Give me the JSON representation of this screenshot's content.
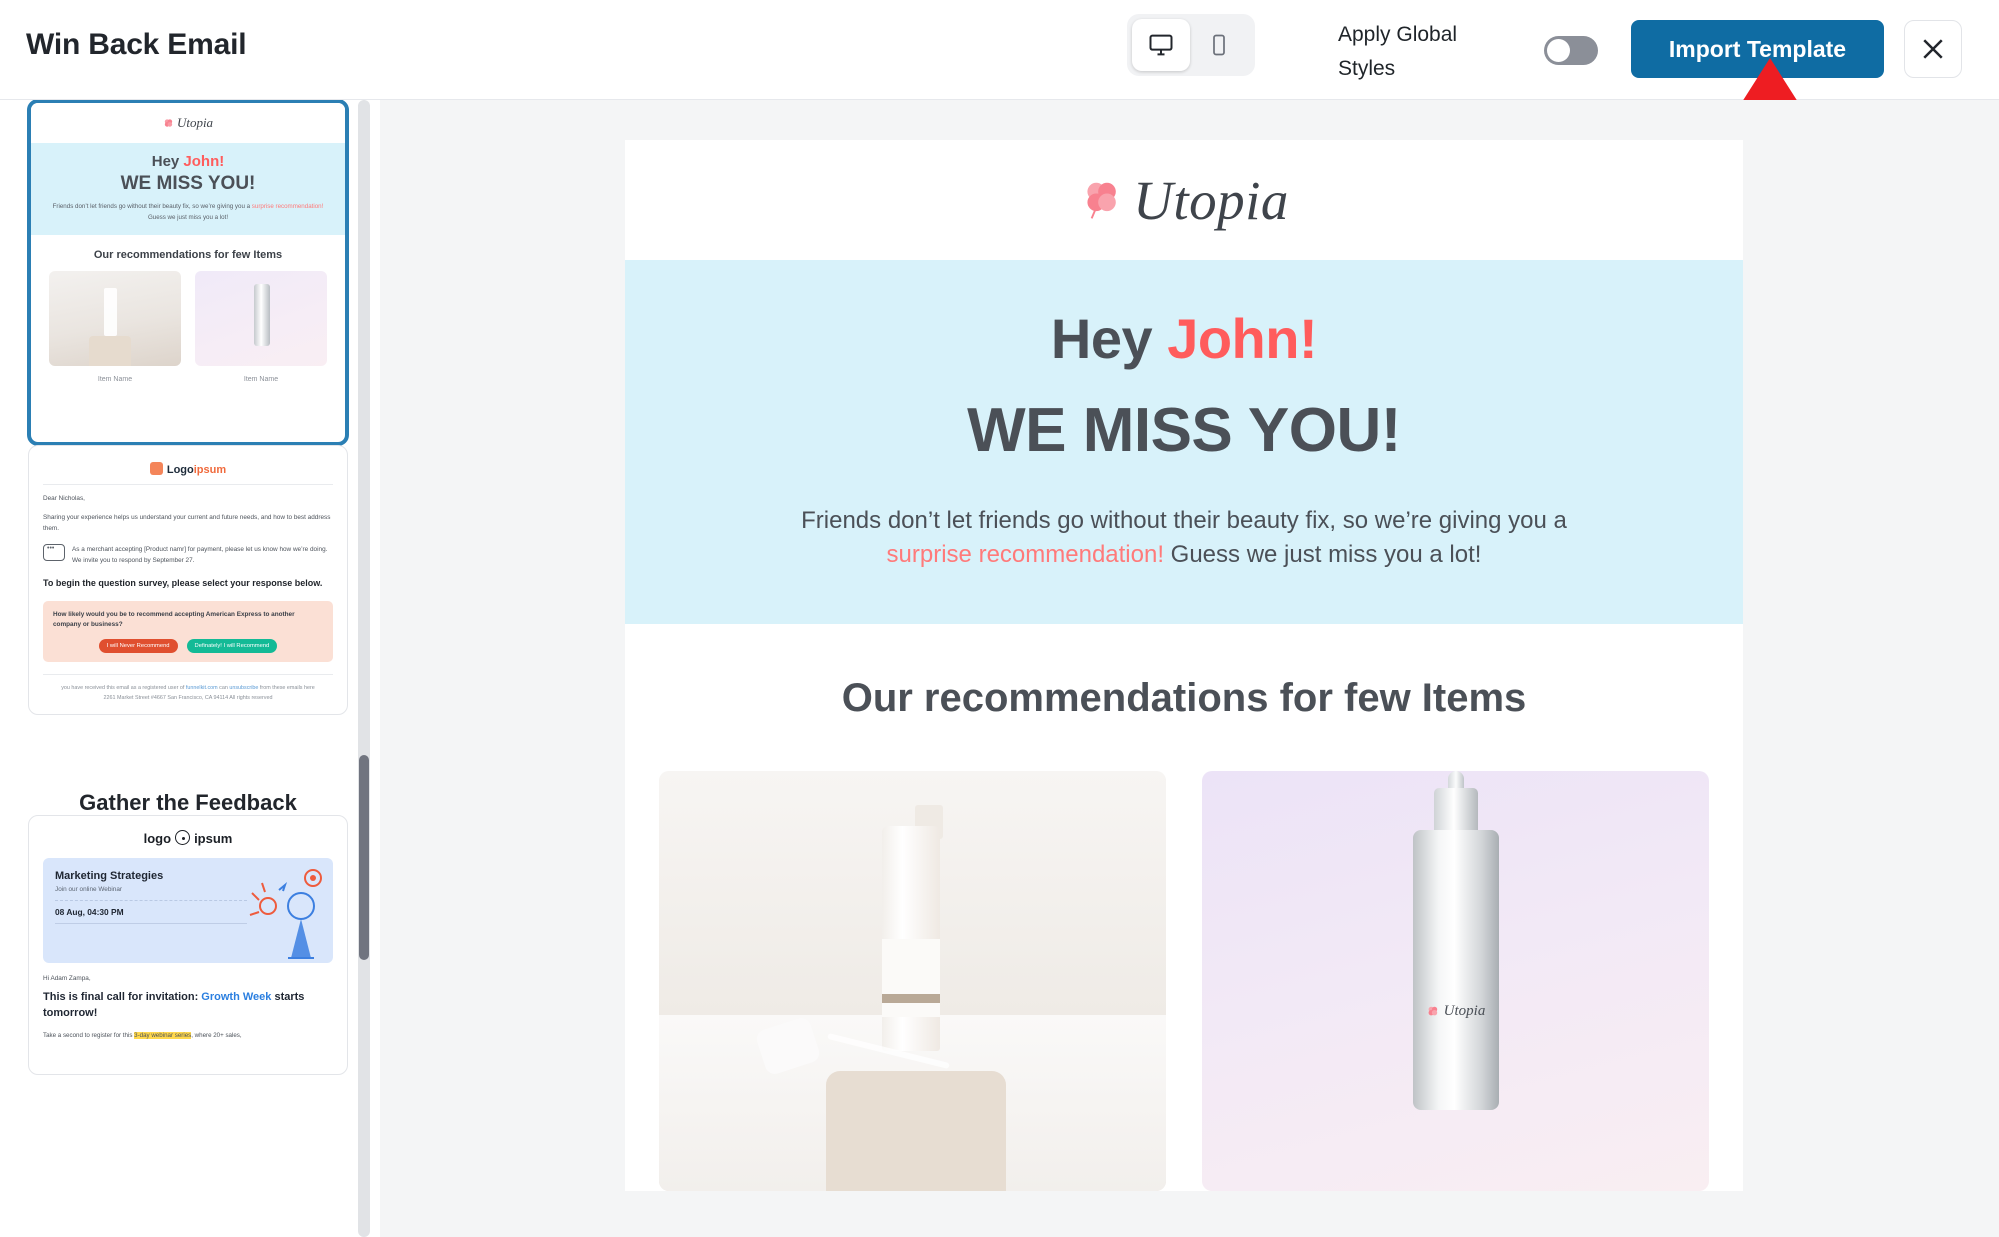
{
  "header": {
    "title": "Win Back Email",
    "device_desktop_icon": "desktop-monitor-icon",
    "device_mobile_icon": "mobile-phone-icon",
    "apply_global_styles_label": "Apply Global Styles",
    "toggle_state": "off",
    "import_button_label": "Import Template",
    "close_icon": "close-x-icon",
    "accent_color": "#0f6ca3",
    "annotation_arrow_color": "#ee1d22"
  },
  "sidebar": {
    "templates": [
      {
        "label": "Win Back Email",
        "selected": true,
        "logo_word": "Utopia",
        "hey": "Hey ",
        "hey_name": "John!",
        "miss": "WE MISS YOU!",
        "body_1": "Friends don’t let friends go without their beauty fix, so we’re giving you a ",
        "body_accent": "surprise recommendation!",
        "body_2": " Guess we just miss you a lot!",
        "rec_title": "Our recommendations for few Items",
        "item_caption_left": "Item Name",
        "item_caption_right": "Item Name"
      },
      {
        "label": "Gather the Feedback",
        "selected": false,
        "logo_main": "Logo",
        "logo_accent": "ipsum",
        "greeting": "Dear Nicholas,",
        "intro": "Sharing your experience helps us understand your current and future needs, and how to best address them.",
        "note": "As a merchant accepting [Product namr] for payment, please let us know how we’re doing. We invite you to respond by September 27.",
        "cta": "To begin the question survey, please select your response below.",
        "question": "How likely would you be to recommend accepting American Express to another company or business?",
        "btn_no": "I will Never Recommend",
        "btn_yes": "Definately! I will Recommend",
        "footer_1": "you have received this email as a registered user of ",
        "footer_link_1": "funnelkit.com",
        "footer_2": " can ",
        "footer_link_2": "unsubscribe",
        "footer_3": " from these emails here",
        "footer_address": "2261 Market Street #4667 San Francisco, CA 94114 All rights reserved"
      },
      {
        "label": "",
        "selected": false,
        "logo_left": "logo",
        "logo_right": "ipsum",
        "card_title": "Marketing Strategies",
        "card_sub": "Join our online Webinar",
        "card_date": "08 Aug, 04:30 PM",
        "greeting": "Hi Adam Zampa,",
        "headline_1": "This is final call for invitation: ",
        "headline_accent": "Growth Week",
        "headline_2": " starts tomorrow!",
        "paragraph_1": "Take a second to register for this ",
        "paragraph_highlight": "3-day webinar series",
        "paragraph_2": ", where 20+ sales,"
      }
    ],
    "scrollbar": "vertical-scrollbar"
  },
  "preview": {
    "logo_word": "Utopia",
    "logo_icon": "clover-flower-icon",
    "hey_prefix": "Hey ",
    "hey_name": "John!",
    "miss_headline": "WE MISS YOU!",
    "body_part_1": "Friends don’t let friends go without their beauty fix, so we’re giving you a ",
    "body_accent": "surprise recommendation!",
    "body_part_2": " Guess we just miss you a lot!",
    "recommendations_title": "Our recommendations for few Items",
    "product_left_alt": "the-ordinary-serum-bottle-photo",
    "product_right_alt": "utopia-dropper-bottle-photo",
    "product_right_brand": "Utopia",
    "hero_bg": "#d8f2fa",
    "accent_red": "#ff5c5c",
    "heading_color": "#4b5057"
  }
}
